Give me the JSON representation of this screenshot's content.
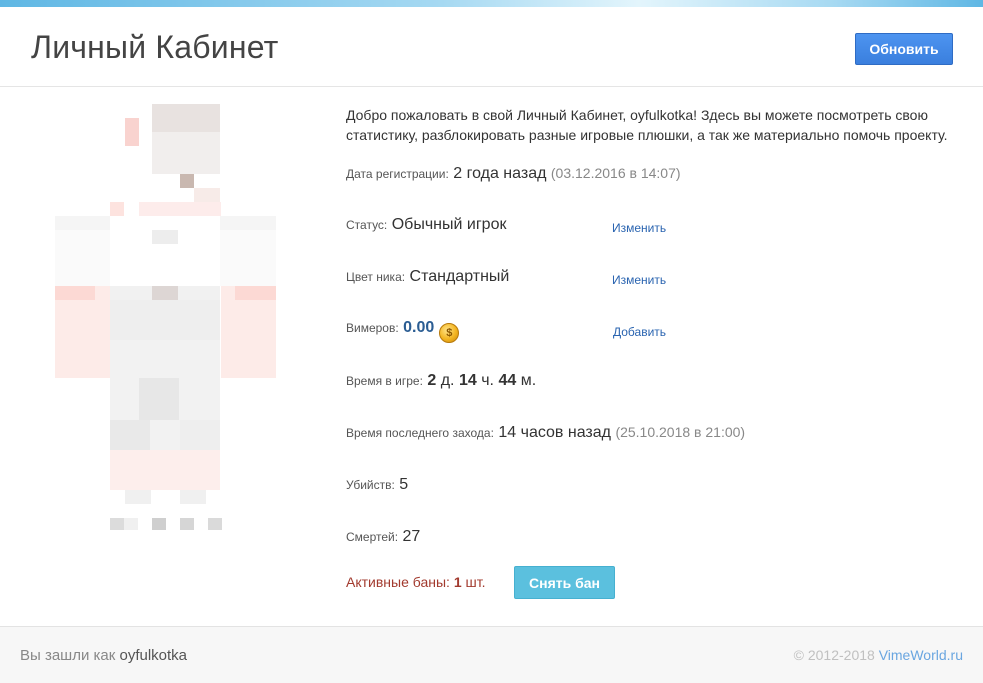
{
  "header": {
    "title": "Личный Кабинет",
    "refresh_label": "Обновить"
  },
  "welcome": {
    "prefix": "Добро пожаловать в свой Личный Кабинет, ",
    "username": "oyfulkotka",
    "suffix": "! Здесь вы можете посмотреть свою статистику, разблокировать разные игровые плюшки, а так же материально помочь проекту."
  },
  "stats": {
    "registration": {
      "label": "Дата регистрации:",
      "value": "2 года назад",
      "detail": "(03.12.2016 в 14:07)"
    },
    "status": {
      "label": "Статус:",
      "value": "Обычный игрок",
      "action": "Изменить"
    },
    "nick_color": {
      "label": "Цвет ника:",
      "value": "Стандартный",
      "action": "Изменить"
    },
    "vimers": {
      "label": "Вимеров:",
      "value": "0.00",
      "action": "Добавить"
    },
    "playtime": {
      "label": "Время в игре:",
      "days": "2",
      "days_unit": "д.",
      "hours": "14",
      "hours_unit": "ч.",
      "minutes": "44",
      "minutes_unit": "м."
    },
    "last_login": {
      "label": "Время последнего захода:",
      "value": "14 часов назад",
      "detail": "(25.10.2018 в 21:00)"
    },
    "kills": {
      "label": "Убийств:",
      "value": "5"
    },
    "deaths": {
      "label": "Смертей:",
      "value": "27"
    }
  },
  "bans": {
    "label": "Активные баны:",
    "count": "1",
    "unit": "шт.",
    "unban_label": "Снять бан"
  },
  "footer": {
    "logged_in_prefix": "Вы зашли как",
    "username": "oyfulkotka",
    "copyright": "© 2012-2018",
    "site_link": "VimeWorld.ru"
  },
  "colors": {
    "primary_button": "#3a7fde",
    "info_button": "#5bc0de",
    "ban_text": "#a23a2e",
    "link": "#2a64b0",
    "coins": "#2b5d93"
  },
  "icons": {
    "coin": "vimer-coin-icon"
  }
}
